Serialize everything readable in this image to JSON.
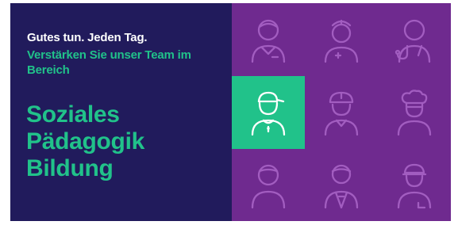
{
  "promo": {
    "tagline": "Gutes tun. Jeden Tag.",
    "subline": "Verstärken Sie unser Team im Bereich",
    "areas": [
      "Soziales",
      "Pädagogik",
      "Bildung"
    ]
  },
  "colors": {
    "navy": "#211b5c",
    "purple": "#6f2a8f",
    "green": "#21c28a",
    "icon_stroke": "#a25dc0"
  },
  "icons": [
    "person-office-icon",
    "person-nurse-icon",
    "person-doctor-stethoscope-icon",
    "person-cap-icon",
    "person-hardhat-icon",
    "person-chef-icon",
    "person-plain-icon",
    "person-suit-icon",
    "person-mechanic-icon"
  ]
}
